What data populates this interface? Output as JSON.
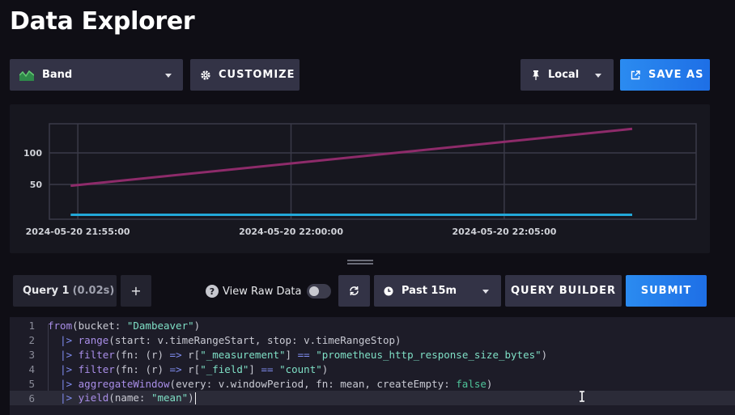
{
  "header": {
    "title": "Data Explorer"
  },
  "toolbar": {
    "graph_type": "Band",
    "customize": "CUSTOMIZE",
    "timezone": "Local",
    "save_as": "SAVE AS"
  },
  "chart_data": {
    "type": "line",
    "x_ticks": [
      "2024-05-20 21:55:00",
      "2024-05-20 22:00:00",
      "2024-05-20 22:05:00"
    ],
    "y_ticks": [
      "100",
      "50"
    ],
    "series": [
      {
        "color": "#8e2b6a",
        "x": [
          "2024-05-20 21:54:50",
          "2024-05-20 22:08:00"
        ],
        "y": [
          48,
          138
        ]
      },
      {
        "color": "#22a8d8",
        "x": [
          "2024-05-20 21:54:50",
          "2024-05-20 22:08:00"
        ],
        "y": [
          2,
          2
        ]
      }
    ]
  },
  "query": {
    "tab_name": "Query 1",
    "tab_meta": "(0.02s)",
    "add_label": "+",
    "view_raw": "View Raw Data",
    "view_raw_on": false,
    "help_icon": "?",
    "time_range": "Past 15m",
    "query_builder": "QUERY BUILDER",
    "submit": "SUBMIT"
  },
  "editor": {
    "line_numbers": [
      "1",
      "2",
      "3",
      "4",
      "5",
      "6"
    ],
    "lines": [
      [
        [
          "kw",
          "from"
        ],
        [
          "t",
          "(bucket: "
        ],
        [
          "str",
          "\"Dambeaver\""
        ],
        [
          "t",
          ")"
        ]
      ],
      [
        [
          "t",
          "  "
        ],
        [
          "pipe",
          "|>"
        ],
        [
          "t",
          " "
        ],
        [
          "kw",
          "range"
        ],
        [
          "t",
          "(start: v.timeRangeStart, stop: v.timeRangeStop)"
        ]
      ],
      [
        [
          "t",
          "  "
        ],
        [
          "pipe",
          "|>"
        ],
        [
          "t",
          " "
        ],
        [
          "kw",
          "filter"
        ],
        [
          "t",
          "(fn: (r) "
        ],
        [
          "pipe",
          "=>"
        ],
        [
          "t",
          " r["
        ],
        [
          "str",
          "\"_measurement\""
        ],
        [
          "t",
          "] "
        ],
        [
          "pipe",
          "=="
        ],
        [
          "t",
          " "
        ],
        [
          "str",
          "\"prometheus_http_response_size_bytes\""
        ],
        [
          "t",
          ")"
        ]
      ],
      [
        [
          "t",
          "  "
        ],
        [
          "pipe",
          "|>"
        ],
        [
          "t",
          " "
        ],
        [
          "kw",
          "filter"
        ],
        [
          "t",
          "(fn: (r) "
        ],
        [
          "pipe",
          "=>"
        ],
        [
          "t",
          " r["
        ],
        [
          "str",
          "\"_field\""
        ],
        [
          "t",
          "] "
        ],
        [
          "pipe",
          "=="
        ],
        [
          "t",
          " "
        ],
        [
          "str",
          "\"count\""
        ],
        [
          "t",
          ")"
        ]
      ],
      [
        [
          "t",
          "  "
        ],
        [
          "pipe",
          "|>"
        ],
        [
          "t",
          " "
        ],
        [
          "kw",
          "aggregateWindow"
        ],
        [
          "t",
          "(every: v.windowPeriod, fn: mean, createEmpty: "
        ],
        [
          "bool",
          "false"
        ],
        [
          "t",
          ")"
        ]
      ],
      [
        [
          "t",
          "  "
        ],
        [
          "pipe",
          "|>"
        ],
        [
          "t",
          " "
        ],
        [
          "kw",
          "yield"
        ],
        [
          "t",
          "(name: "
        ],
        [
          "str",
          "\"mean\""
        ],
        [
          "t",
          ")"
        ]
      ]
    ]
  }
}
